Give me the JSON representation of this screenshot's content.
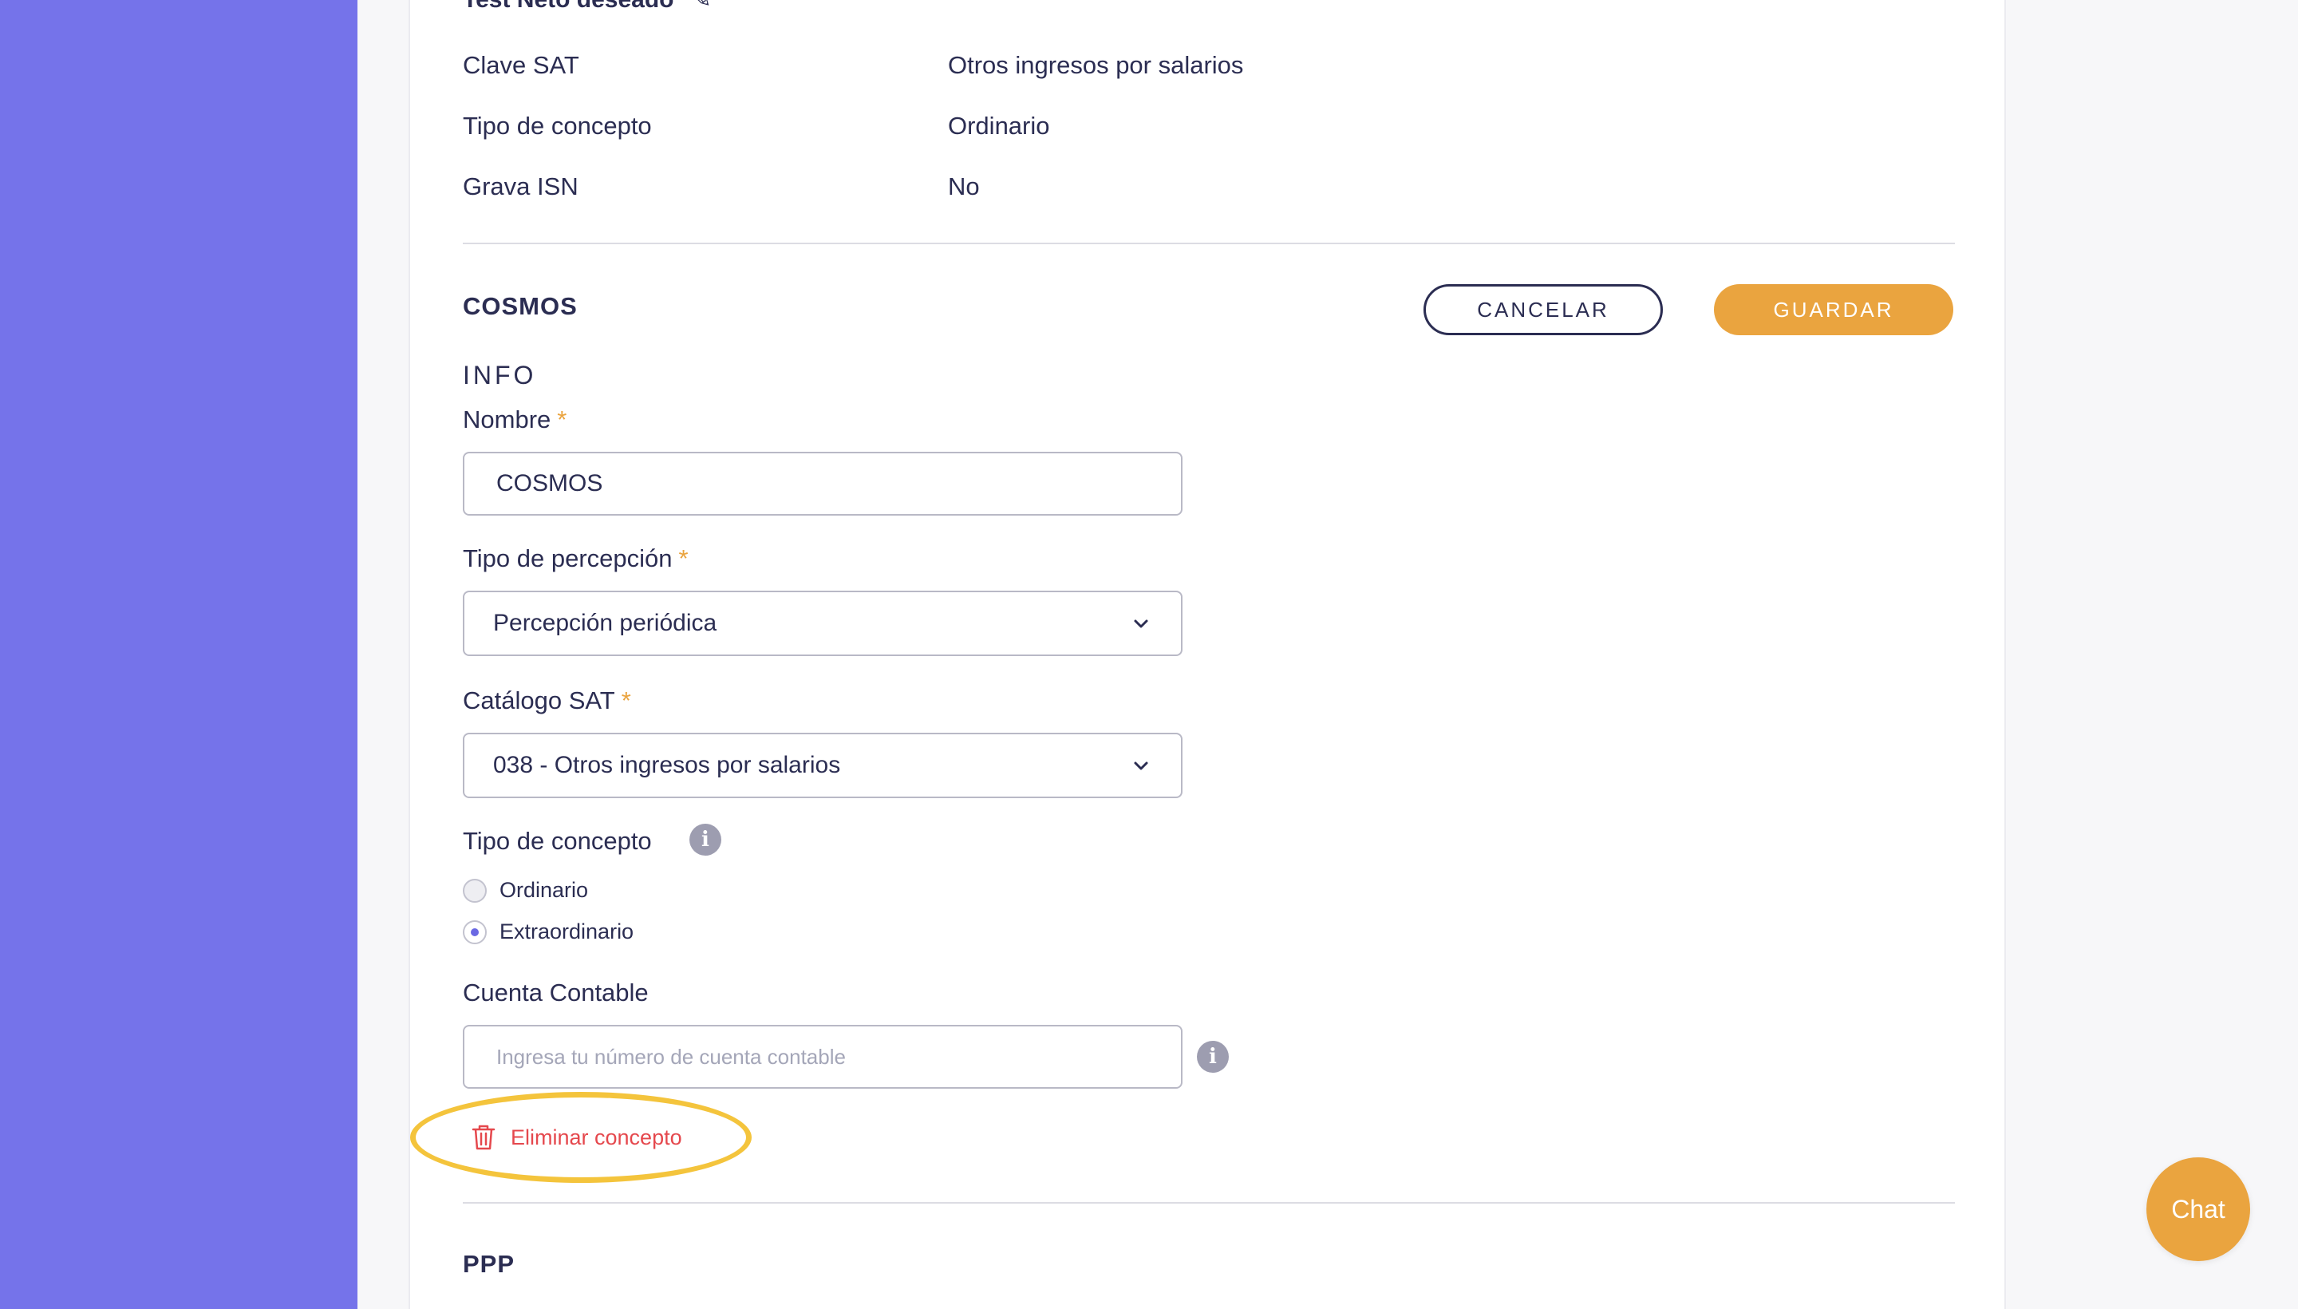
{
  "previous_section": {
    "title": "Test Neto deseado",
    "rows": [
      {
        "label": "Clave SAT",
        "value": "Otros ingresos por salarios"
      },
      {
        "label": "Tipo de concepto",
        "value": "Ordinario"
      },
      {
        "label": "Grava ISN",
        "value": "No"
      }
    ]
  },
  "section": {
    "title": "COSMOS",
    "cancel_label": "CANCELAR",
    "save_label": "GUARDAR",
    "info_heading": "INFO",
    "required_mark": "*",
    "name_label": "Nombre",
    "name_value": "COSMOS",
    "perception_label": "Tipo de percepción",
    "perception_value": "Percepción periódica",
    "catalog_label": "Catálogo SAT",
    "catalog_value": "038 - Otros ingresos por salarios",
    "concept_type_label": "Tipo de concepto",
    "concept_options": [
      {
        "label": "Ordinario",
        "selected": false
      },
      {
        "label": "Extraordinario",
        "selected": true
      }
    ],
    "account_label": "Cuenta Contable",
    "account_placeholder": "Ingresa tu número de cuenta contable",
    "account_value": "",
    "delete_label": "Eliminar concepto"
  },
  "next_section": {
    "title": "PPP"
  },
  "chat": {
    "label": "Chat"
  },
  "colors": {
    "sidebar": "#7573ea",
    "accent": "#eaa43f",
    "danger": "#e5484d",
    "highlight": "#f4c43c",
    "text": "#2b2d52"
  }
}
